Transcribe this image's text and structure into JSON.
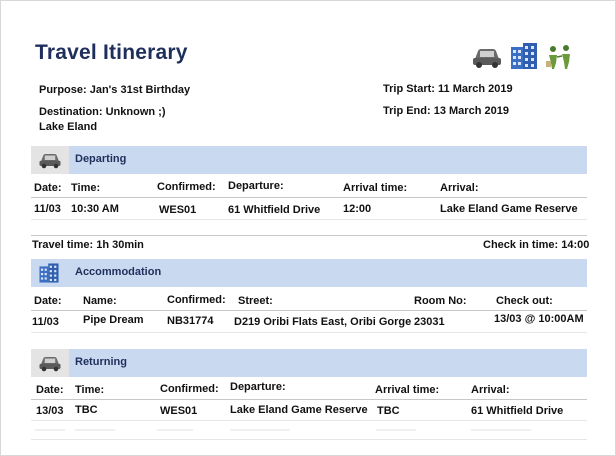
{
  "title": "Travel Itinerary",
  "header_icons": [
    "car-icon",
    "building-icon",
    "people-icon"
  ],
  "purpose": "Purpose: Jan's 31st Birthday",
  "destination": "Destination: Unknown ;)",
  "destination_line2": "Lake Eland",
  "trip_start": "Trip Start: 11 March 2019",
  "trip_end": "Trip End: 13 March 2019",
  "departing": {
    "title": "Departing",
    "headers": [
      "Date:",
      "Time:",
      "Confirmed:",
      "Departure:",
      "Arrival time:",
      "Arrival:"
    ],
    "row": [
      "11/03",
      "10:30 AM",
      "WES01",
      "61 Whitfield Drive",
      "12:00",
      "Lake Eland Game Reserve"
    ]
  },
  "travel_time": "Travel time: 1h 30min",
  "check_in": "Check in time: 14:00",
  "accommodation": {
    "title": "Accommodation",
    "headers": [
      "Date:",
      "Name:",
      "Confirmed:",
      "Street:",
      "Room No:",
      "Check out:"
    ],
    "row": [
      "11/03",
      "Pipe Dream",
      "NB31774",
      "D219 Oribi Flats East, Oribi Gorge",
      "23031",
      "13/03 @ 10:00AM"
    ]
  },
  "returning": {
    "title": "Returning",
    "headers": [
      "Date:",
      "Time:",
      "Confirmed:",
      "Departure:",
      "Arrival time:",
      "Arrival:"
    ],
    "row": [
      "13/03",
      "TBC",
      "WES01",
      "Lake Eland Game Reserve",
      "TBC",
      "61 Whitfield Drive"
    ]
  },
  "colors": {
    "title": "#1f2f5c",
    "section_bar": "#c9d9f0",
    "icon_box": "#e4e4e4",
    "building_icon": "#3a6fc4"
  }
}
